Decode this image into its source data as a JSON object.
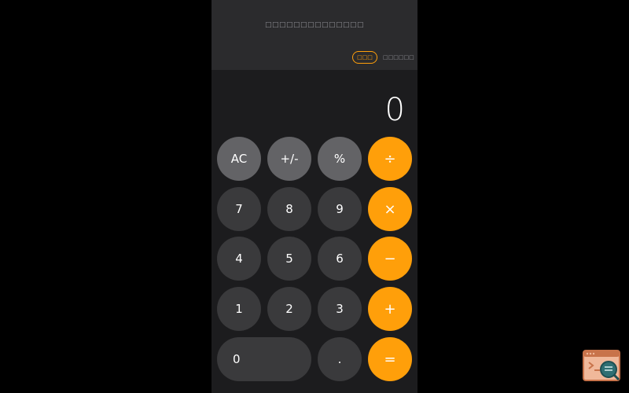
{
  "header": {
    "title": "□□□□□□□□□□□□□□",
    "tabs": [
      {
        "label": "□□□",
        "active": true
      },
      {
        "label": "□□□□□□",
        "active": false
      }
    ]
  },
  "display": {
    "value": "0"
  },
  "keypad": {
    "row0": [
      "AC",
      "+/-",
      "%",
      "÷"
    ],
    "row1": [
      "7",
      "8",
      "9",
      "×"
    ],
    "row2": [
      "4",
      "5",
      "6",
      "−"
    ],
    "row3": [
      "1",
      "2",
      "3",
      "+"
    ],
    "row4": [
      "0",
      ".",
      "="
    ]
  },
  "colors": {
    "accent": "#ff9f0a",
    "function_key": "#636366",
    "number_key": "#3a3a3c",
    "panel": "#1c1c1e",
    "header": "#2b2b2d"
  },
  "icons": {
    "corner_logo": "terminal-search-logo-icon"
  }
}
